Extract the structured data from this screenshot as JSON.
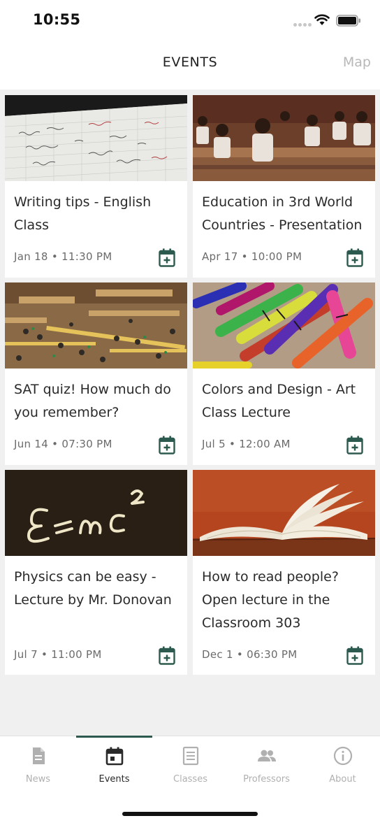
{
  "status_bar": {
    "time": "10:55"
  },
  "header": {
    "title": "EVENTS",
    "map_label": "Map"
  },
  "events": [
    {
      "title": "Writing tips - English Class",
      "date": "Jan 18 • 11:30 PM",
      "image": "notebook-photo"
    },
    {
      "title": "Education in 3rd World Countries - Presentation",
      "date": "Apr 17 • 10:00 PM",
      "image": "classroom-photo"
    },
    {
      "title": "SAT quiz! How much do you remember?",
      "date": "Jun 14 • 07:30 PM",
      "image": "library-photo"
    },
    {
      "title": "Colors and Design - Art Class Lecture",
      "date": "Jul 5 • 12:00 AM",
      "image": "crayons-photo"
    },
    {
      "title": "Physics can be easy - Lecture by Mr. Donovan",
      "date": "Jul 7 • 11:00 PM",
      "image": "chalkboard-photo"
    },
    {
      "title": "How to read people? Open lecture in the Classroom 303",
      "date": "Dec 1 • 06:30 PM",
      "image": "open-book-photo"
    }
  ],
  "tabs": [
    {
      "label": "News",
      "icon": "document-icon"
    },
    {
      "label": "Events",
      "icon": "calendar-icon",
      "active": true
    },
    {
      "label": "Classes",
      "icon": "list-document-icon"
    },
    {
      "label": "Professors",
      "icon": "people-icon"
    },
    {
      "label": "About",
      "icon": "info-icon"
    }
  ],
  "colors": {
    "accent": "#2d5a4e",
    "inactive": "#b0b0b0",
    "background": "#f0f0f0"
  }
}
